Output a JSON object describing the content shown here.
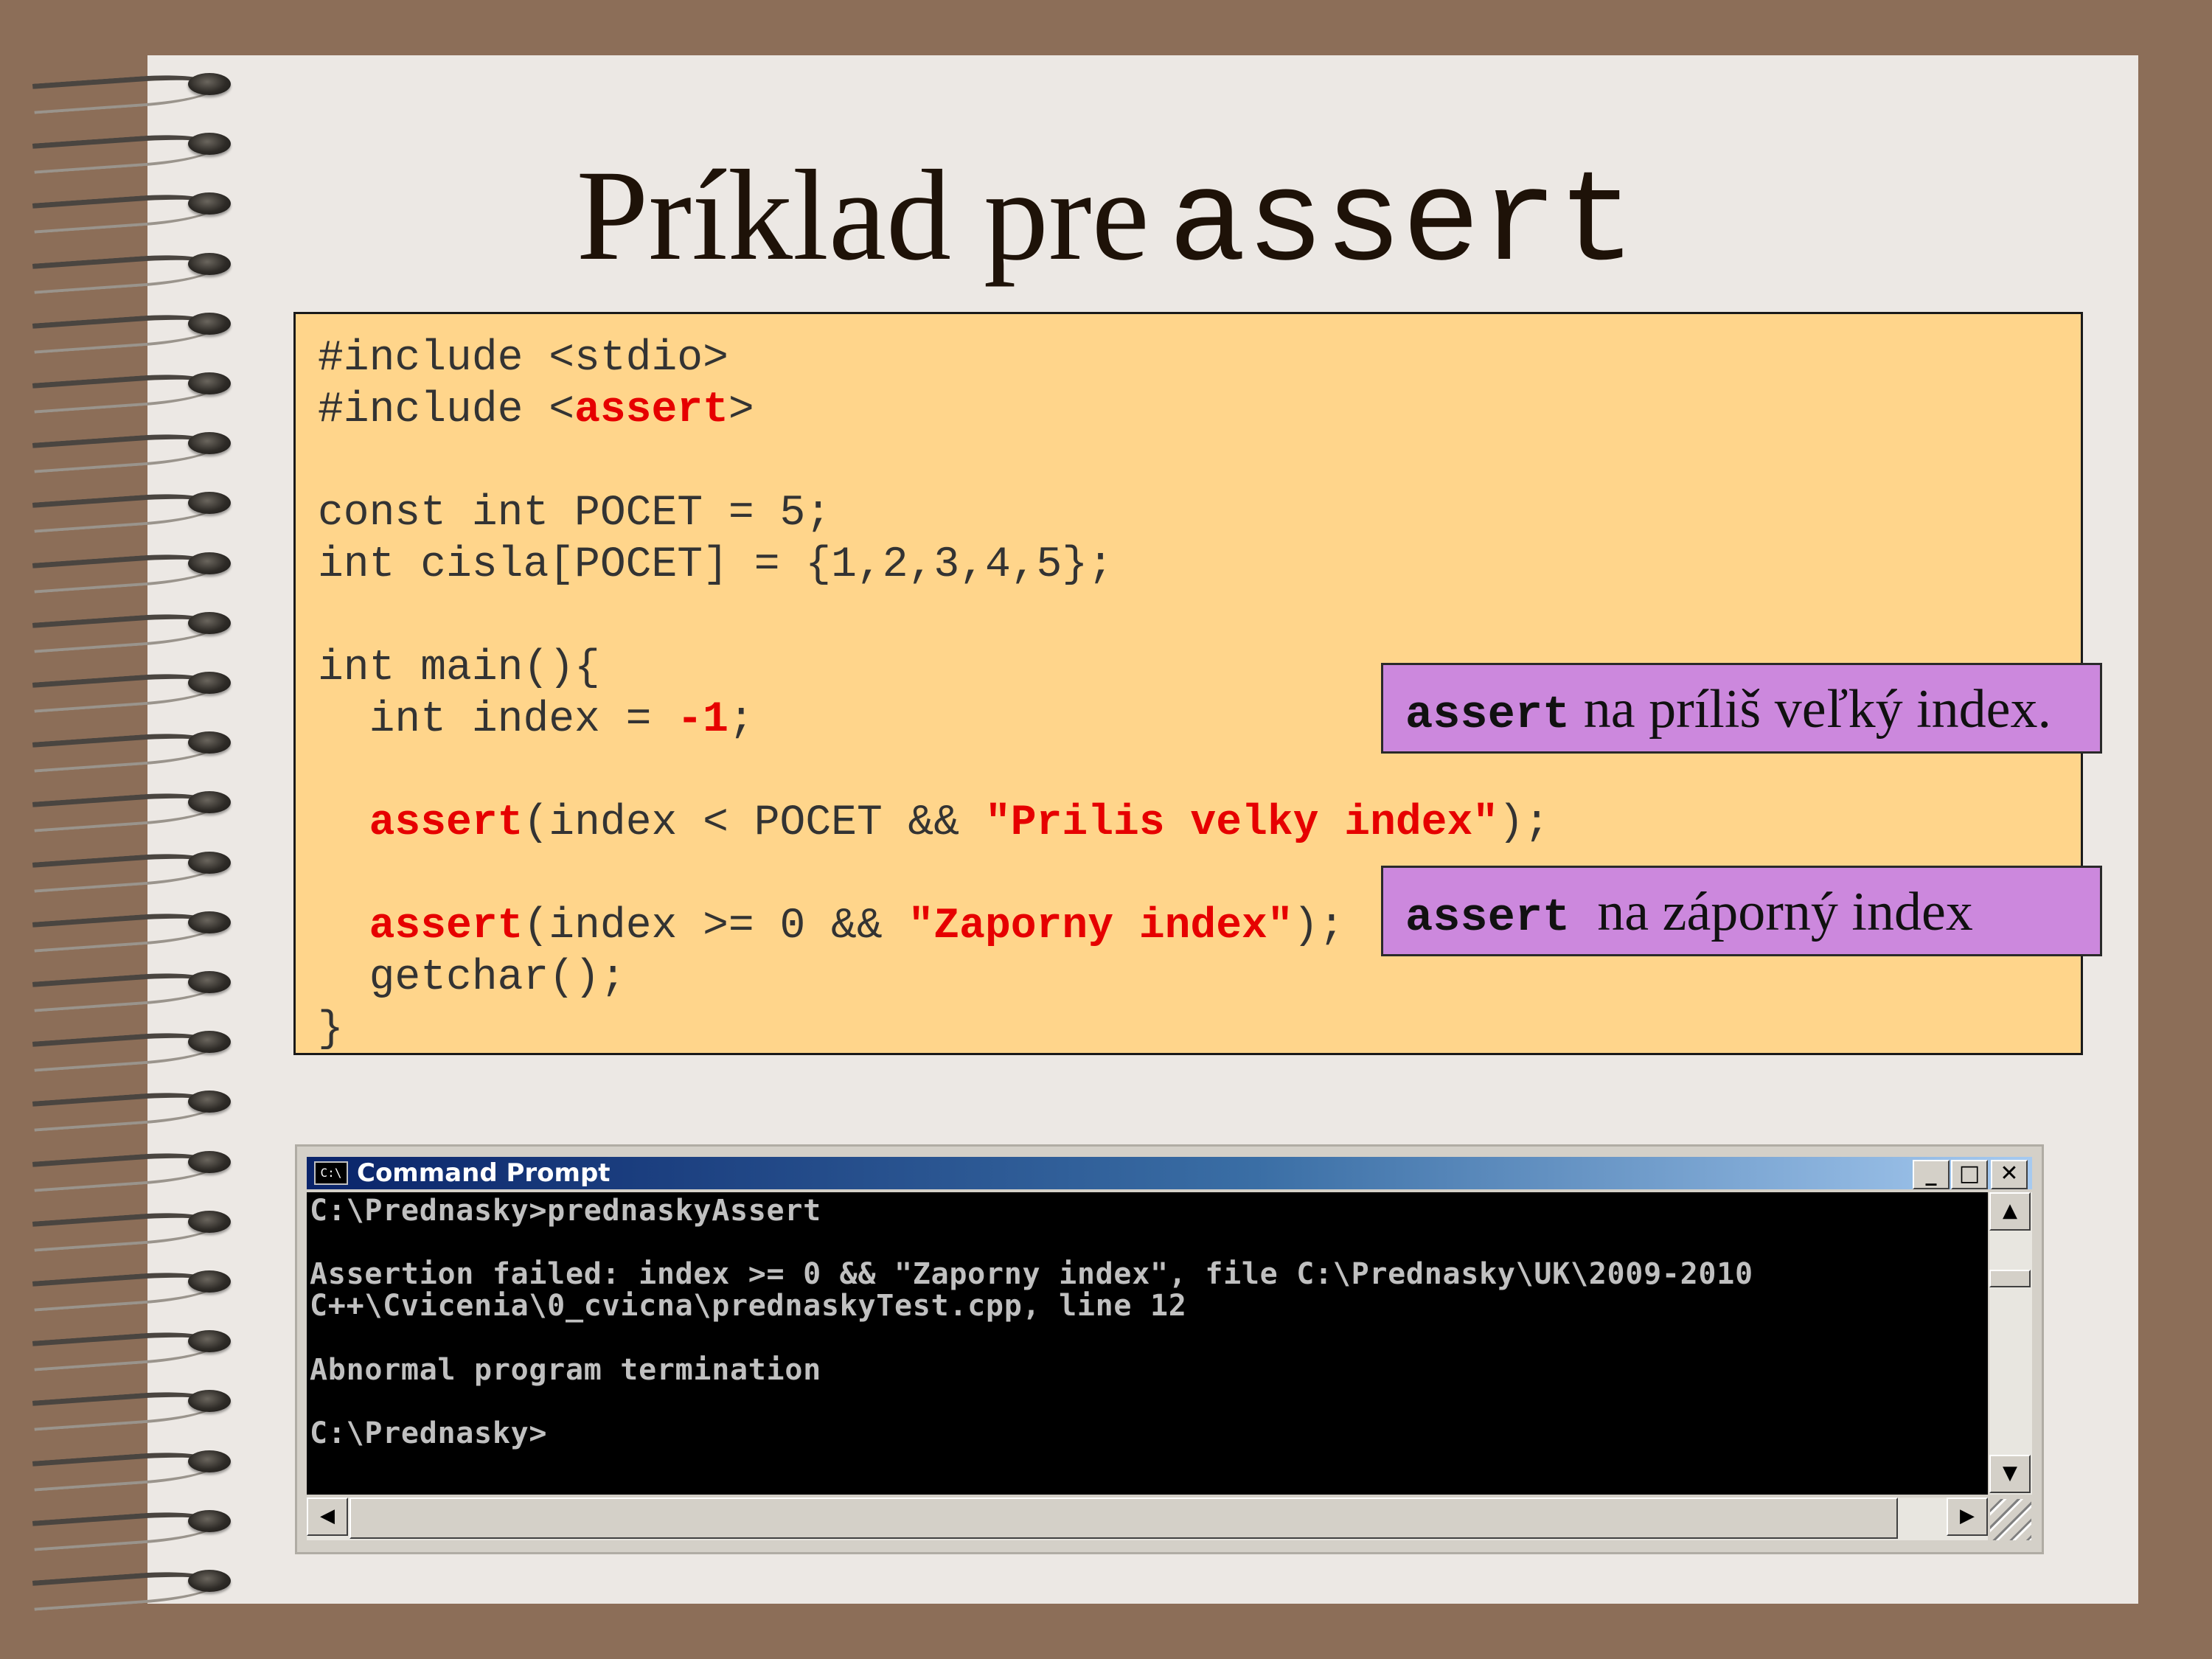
{
  "slide": {
    "title_text": "Príklad pre",
    "title_code": "assert"
  },
  "code": {
    "line1": "#include <stdio>",
    "line2_pre": "#include <",
    "line2_kw": "assert",
    "line2_post": ">",
    "line3": "const int POCET = 5;",
    "line4": "int cisla[POCET] = {1,2,3,4,5};",
    "line5": "int main(){",
    "line6_pre": "  int index = ",
    "line6_val": "-1",
    "line6_post": ";",
    "line7_kw": "assert",
    "line7_mid": "(index < POCET && ",
    "line7_str": "\"Prilis velky index\"",
    "line7_post": ");",
    "line8_kw": "assert",
    "line8_mid": "(index >= 0 && ",
    "line8_str": "\"Zaporny index\"",
    "line8_post": ");",
    "line9": "  getchar();",
    "line10": "}"
  },
  "notes": {
    "note1_kw": "assert",
    "note1_text": " na príliš veľký index.",
    "note2_kw": "assert",
    "note2_text": "  na záporný index"
  },
  "cmd": {
    "icon": "C:\\",
    "title": "Command Prompt",
    "min": "_",
    "max": "□",
    "close": "✕",
    "lines": [
      "C:\\Prednasky>prednaskyAssert",
      "Assertion failed: index >= 0 && \"Zaporny index\", file C:\\Prednasky\\UK\\2009-2010",
      "C++\\Cvicenia\\0_cvicna\\prednaskyTest.cpp, line 12",
      "Abnormal program termination",
      "C:\\Prednasky>"
    ],
    "scroll_up": "▲",
    "scroll_down": "▼",
    "scroll_left": "◀",
    "scroll_right": "▶"
  },
  "colors": {
    "background": "#8c6e58",
    "page": "#ece8e4",
    "code_box": "#ffd58b",
    "note_box": "#cc88dd",
    "keyword_red": "#e60000"
  }
}
